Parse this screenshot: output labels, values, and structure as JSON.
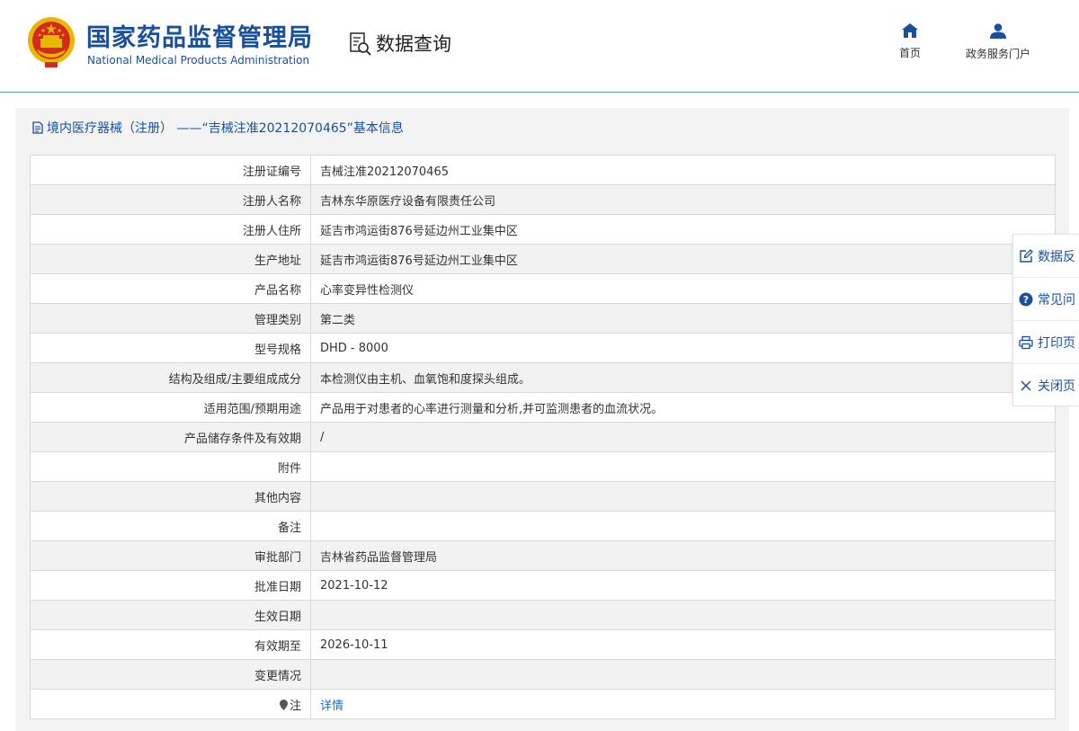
{
  "header": {
    "logo_cn": "国家药品监督管理局",
    "logo_en": "National Medical Products Administration",
    "section_title": "数据查询",
    "nav": [
      {
        "label": "首页",
        "icon": "home-icon"
      },
      {
        "label": "政务服务门户",
        "icon": "user-icon"
      }
    ]
  },
  "panel": {
    "title": "境内医疗器械（注册） ——“吉械注准20212070465”基本信息"
  },
  "rows": [
    {
      "label": "注册证编号",
      "value": "吉械注准20212070465"
    },
    {
      "label": "注册人名称",
      "value": "吉林东华原医疗设备有限责任公司"
    },
    {
      "label": "注册人住所",
      "value": "延吉市鸿运街876号延边州工业集中区"
    },
    {
      "label": "生产地址",
      "value": "延吉市鸿运街876号延边州工业集中区"
    },
    {
      "label": "产品名称",
      "value": "心率变异性检测仪"
    },
    {
      "label": "管理类别",
      "value": "第二类"
    },
    {
      "label": "型号规格",
      "value": "DHD - 8000"
    },
    {
      "label": "结构及组成/主要组成成分",
      "value": "本检测仪由主机、血氧饱和度探头组成。"
    },
    {
      "label": "适用范围/预期用途",
      "value": "产品用于对患者的心率进行测量和分析,并可监测患者的血流状况。"
    },
    {
      "label": "产品储存条件及有效期",
      "value": "/"
    },
    {
      "label": "附件",
      "value": ""
    },
    {
      "label": "其他内容",
      "value": ""
    },
    {
      "label": "备注",
      "value": ""
    },
    {
      "label": "审批部门",
      "value": "吉林省药品监督管理局"
    },
    {
      "label": "批准日期",
      "value": "2021-10-12"
    },
    {
      "label": "生效日期",
      "value": ""
    },
    {
      "label": "有效期至",
      "value": "2026-10-11"
    },
    {
      "label": "变更情况",
      "value": ""
    },
    {
      "label": "注",
      "value": "详情"
    }
  ],
  "side_panel": [
    {
      "label": "数据反",
      "icon": "edit-icon"
    },
    {
      "label": "常见问",
      "icon": "question-icon"
    },
    {
      "label": "打印页",
      "icon": "printer-icon"
    },
    {
      "label": "关闭页",
      "icon": "close-icon"
    }
  ],
  "colors": {
    "brand_blue": "#1a4f9c",
    "link_blue": "#1a6fc4",
    "emblem_red": "#d42a1e",
    "emblem_gold": "#e8b800"
  }
}
